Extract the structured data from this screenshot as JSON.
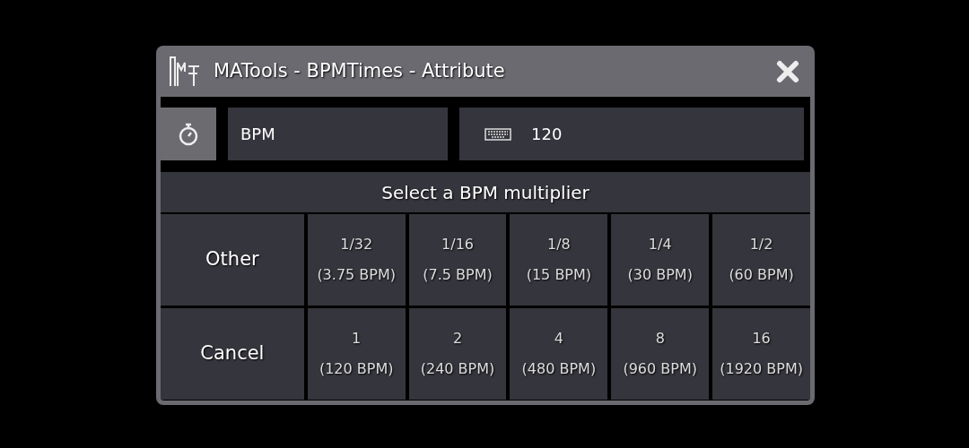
{
  "window": {
    "title": "MATools - BPMTimes - Attribute"
  },
  "inputs": {
    "label": "BPM",
    "value": "120"
  },
  "prompt": "Select a BPM multiplier",
  "rows": [
    {
      "action": "Other",
      "options": [
        {
          "factor": "1/32",
          "bpm": "(3.75 BPM)"
        },
        {
          "factor": "1/16",
          "bpm": "(7.5 BPM)"
        },
        {
          "factor": "1/8",
          "bpm": "(15 BPM)"
        },
        {
          "factor": "1/4",
          "bpm": "(30 BPM)"
        },
        {
          "factor": "1/2",
          "bpm": "(60 BPM)"
        }
      ]
    },
    {
      "action": "Cancel",
      "options": [
        {
          "factor": "1",
          "bpm": "(120 BPM)"
        },
        {
          "factor": "2",
          "bpm": "(240 BPM)"
        },
        {
          "factor": "4",
          "bpm": "(480 BPM)"
        },
        {
          "factor": "8",
          "bpm": "(960 BPM)"
        },
        {
          "factor": "16",
          "bpm": "(1920 BPM)"
        }
      ]
    }
  ]
}
